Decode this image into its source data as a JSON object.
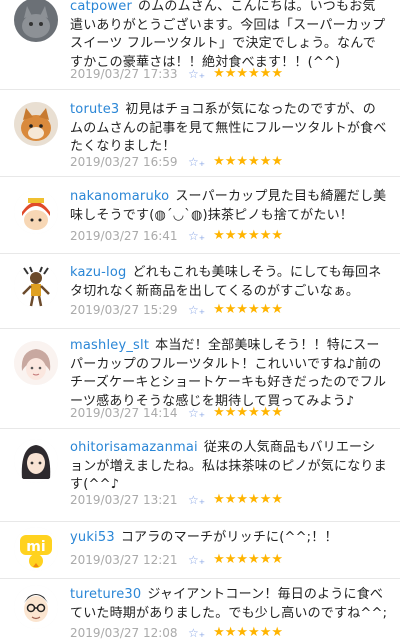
{
  "comments": [
    {
      "user": "catpower",
      "text": "のムのムさん、こんにちは。いつもお気遣いありがとうございます。今回は「スーパーカップスイーツ フルーツタルト」で決定でしょう。なんですかこの豪華さは！！絶対食べます！！(^^)",
      "date": "2019/03/27 17:33",
      "add_star_icon": "star-outline-plus",
      "stars": "★★★★★★"
    },
    {
      "user": "torute3",
      "text": "初見はチョコ系が気になったのですが、のムのムさんの記事を見て無性にフルーツタルトが食べたくなりました！",
      "date": "2019/03/27 16:59",
      "add_star_icon": "star-outline-plus",
      "stars": "★★★★★★"
    },
    {
      "user": "nakanomaruko",
      "text": "スーパーカップ見た目も綺麗だし美味しそうです(◍´◡`◍)抹茶ピノも捨てがたい！",
      "date": "2019/03/27 16:41",
      "add_star_icon": "star-outline-plus",
      "stars": "★★★★★★"
    },
    {
      "user": "kazu-log",
      "text": "どれもこれも美味しそう。にしても毎回ネタ切れなく新商品を出してくるのがすごいなぁ。",
      "date": "2019/03/27 15:29",
      "add_star_icon": "star-outline-plus",
      "stars": "★★★★★★"
    },
    {
      "user": "mashley_slt",
      "text": "本当だ！全部美味しそう！！特にスーパーカップのフルーツタルト！これいいですね♪前のチーズケーキとショートケーキも好きだったのでフルーツ感ありそうな感じを期待して買ってみよう♪",
      "date": "2019/03/27 14:14",
      "add_star_icon": "star-outline-plus",
      "stars": "★★★★★★"
    },
    {
      "user": "ohitorisamazanmai",
      "text": "従来の人気商品もバリエーションが増えましたね。私は抹茶味のピノが気になります(^^♪",
      "date": "2019/03/27 13:21",
      "add_star_icon": "star-outline-plus",
      "stars": "★★★★★★"
    },
    {
      "user": "yuki53",
      "text": "コアラのマーチがリッチに(^^;！！",
      "date": "2019/03/27 12:21",
      "add_star_icon": "star-outline-plus",
      "stars": "★★★★★★"
    },
    {
      "user": "tureture30",
      "text": "ジャイアントコーン！毎日のように食べていた時期がありました。でも少し高いのですね^^;",
      "date": "2019/03/27 12:08",
      "add_star_icon": "star-outline-plus",
      "stars": "★★★★★★"
    }
  ]
}
